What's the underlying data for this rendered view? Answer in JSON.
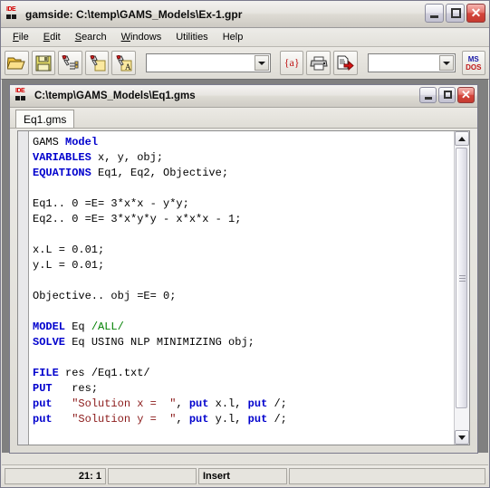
{
  "window": {
    "icon": "ide-icon",
    "title": "gamside: C:\\temp\\GAMS_Models\\Ex-1.gpr",
    "controls": {
      "minimize": "_",
      "maximize": "□",
      "close": "✕"
    }
  },
  "menubar": {
    "items": [
      {
        "label": "File",
        "name": "menu-file"
      },
      {
        "label": "Edit",
        "name": "menu-edit"
      },
      {
        "label": "Search",
        "name": "menu-search"
      },
      {
        "label": "Windows",
        "name": "menu-windows"
      },
      {
        "label": "Utilities",
        "name": "menu-utilities"
      },
      {
        "label": "Help",
        "name": "menu-help"
      }
    ]
  },
  "toolbar": {
    "buttons": [
      {
        "name": "open-folder-icon",
        "glyph": "folder"
      },
      {
        "name": "save-icon",
        "glyph": "floppy"
      },
      {
        "name": "search-list-icon",
        "glyph": "flashlight-list"
      },
      {
        "name": "search-page-icon",
        "glyph": "flashlight-page"
      },
      {
        "name": "search-text-icon",
        "glyph": "flashlight-a"
      }
    ],
    "combo1": {
      "value": "",
      "placeholder": ""
    },
    "buttons2": [
      {
        "name": "macro-icon",
        "glyph": "{a}"
      },
      {
        "name": "print-icon",
        "glyph": "printer"
      },
      {
        "name": "run-icon",
        "glyph": "page-arrow"
      }
    ],
    "combo2": {
      "value": "",
      "placeholder": ""
    },
    "msdos": {
      "name": "msdos-icon",
      "line1": "MS",
      "line2": "DOS"
    }
  },
  "child_window": {
    "icon": "ide-icon",
    "title": "C:\\temp\\GAMS_Models\\Eq1.gms",
    "controls": {
      "minimize": "_",
      "maximize": "□",
      "close": "✕"
    },
    "tabs": [
      {
        "label": "Eq1.gms",
        "active": true
      }
    ]
  },
  "editor": {
    "lines": [
      [
        {
          "t": "GAMS ",
          "c": "plain"
        },
        {
          "t": "Model",
          "c": "kw"
        }
      ],
      [
        {
          "t": "VARIABLES",
          "c": "kw"
        },
        {
          "t": " x, y, obj;",
          "c": "plain"
        }
      ],
      [
        {
          "t": "EQUATIONS",
          "c": "kw"
        },
        {
          "t": " Eq1, Eq2, Objective;",
          "c": "plain"
        }
      ],
      [],
      [
        {
          "t": "Eq1.. 0 =E= 3*x*x - y*y;",
          "c": "plain"
        }
      ],
      [
        {
          "t": "Eq2.. 0 =E= 3*x*y*y - x*x*x - 1;",
          "c": "plain"
        }
      ],
      [],
      [
        {
          "t": "x.L = 0.01;",
          "c": "plain"
        }
      ],
      [
        {
          "t": "y.L = 0.01;",
          "c": "plain"
        }
      ],
      [],
      [
        {
          "t": "Objective.. obj =E= 0;",
          "c": "plain"
        }
      ],
      [],
      [
        {
          "t": "MODEL",
          "c": "kw"
        },
        {
          "t": " Eq ",
          "c": "plain"
        },
        {
          "t": "/ALL/",
          "c": "grn"
        }
      ],
      [
        {
          "t": "SOLVE",
          "c": "kw"
        },
        {
          "t": " Eq USING NLP MINIMIZING obj;",
          "c": "plain"
        }
      ],
      [],
      [
        {
          "t": "FILE",
          "c": "kw"
        },
        {
          "t": " res /Eq1.txt/",
          "c": "plain"
        }
      ],
      [
        {
          "t": "PUT",
          "c": "kw"
        },
        {
          "t": "   res;",
          "c": "plain"
        }
      ],
      [
        {
          "t": "put",
          "c": "kw"
        },
        {
          "t": "   ",
          "c": "plain"
        },
        {
          "t": "\"Solution x =  \"",
          "c": "str"
        },
        {
          "t": ", ",
          "c": "plain"
        },
        {
          "t": "put",
          "c": "kw"
        },
        {
          "t": " x.l, ",
          "c": "plain"
        },
        {
          "t": "put",
          "c": "kw"
        },
        {
          "t": " /;",
          "c": "plain"
        }
      ],
      [
        {
          "t": "put",
          "c": "kw"
        },
        {
          "t": "   ",
          "c": "plain"
        },
        {
          "t": "\"Solution y =  \"",
          "c": "str"
        },
        {
          "t": ", ",
          "c": "plain"
        },
        {
          "t": "put",
          "c": "kw"
        },
        {
          "t": " y.l, ",
          "c": "plain"
        },
        {
          "t": "put",
          "c": "kw"
        },
        {
          "t": " /;",
          "c": "plain"
        }
      ],
      [],
      []
    ],
    "scrollbar": {
      "up": "▲",
      "down": "▼"
    }
  },
  "statusbar": {
    "cursor_position": "21: 1",
    "panel2": "",
    "insert_mode": "Insert",
    "panel4": ""
  },
  "colors": {
    "keyword": "#0000cd",
    "string": "#8b1a1a",
    "comment_green": "#008000",
    "editor_bg": "#ffffff",
    "mdi_bg": "#808080",
    "close_red": "#d3463c"
  }
}
